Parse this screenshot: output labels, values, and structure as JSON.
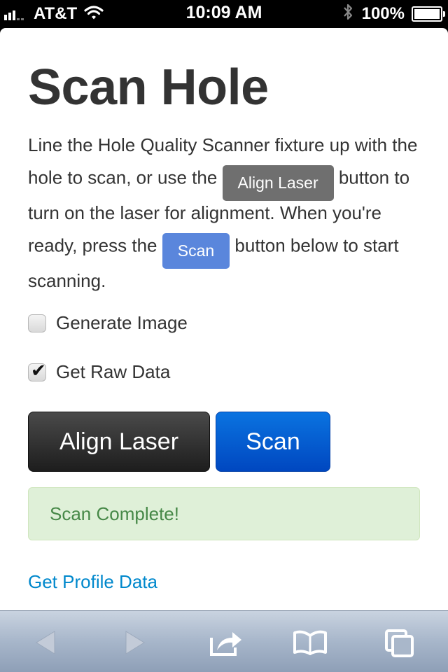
{
  "status_bar": {
    "carrier": "AT&T",
    "time": "10:09 AM",
    "battery": "100%"
  },
  "page": {
    "title": "Scan Hole",
    "intro": {
      "part1": "Line the Hole Quality Scanner fixture up with the hole to scan, or use the",
      "inline_align_label": "Align Laser",
      "part2": "button to turn on the laser for alignment. When you're ready, press the",
      "inline_scan_label": "Scan",
      "part3": "button below to start scanning."
    },
    "options": [
      {
        "label": "Generate Image",
        "checked": false
      },
      {
        "label": "Get Raw Data",
        "checked": true
      }
    ],
    "buttons": {
      "align_label": "Align Laser",
      "scan_label": "Scan"
    },
    "alert": "Scan Complete!",
    "profile_link": "Get Profile Data"
  },
  "toolbar": {
    "icons": [
      "back-icon",
      "forward-icon",
      "share-icon",
      "bookmarks-icon",
      "tabs-icon"
    ]
  },
  "colors": {
    "align_button": "#2b2b2b",
    "scan_button": "#0059d6",
    "alert_bg": "#dff0d8",
    "alert_text": "#468847",
    "link": "#0088cc"
  }
}
